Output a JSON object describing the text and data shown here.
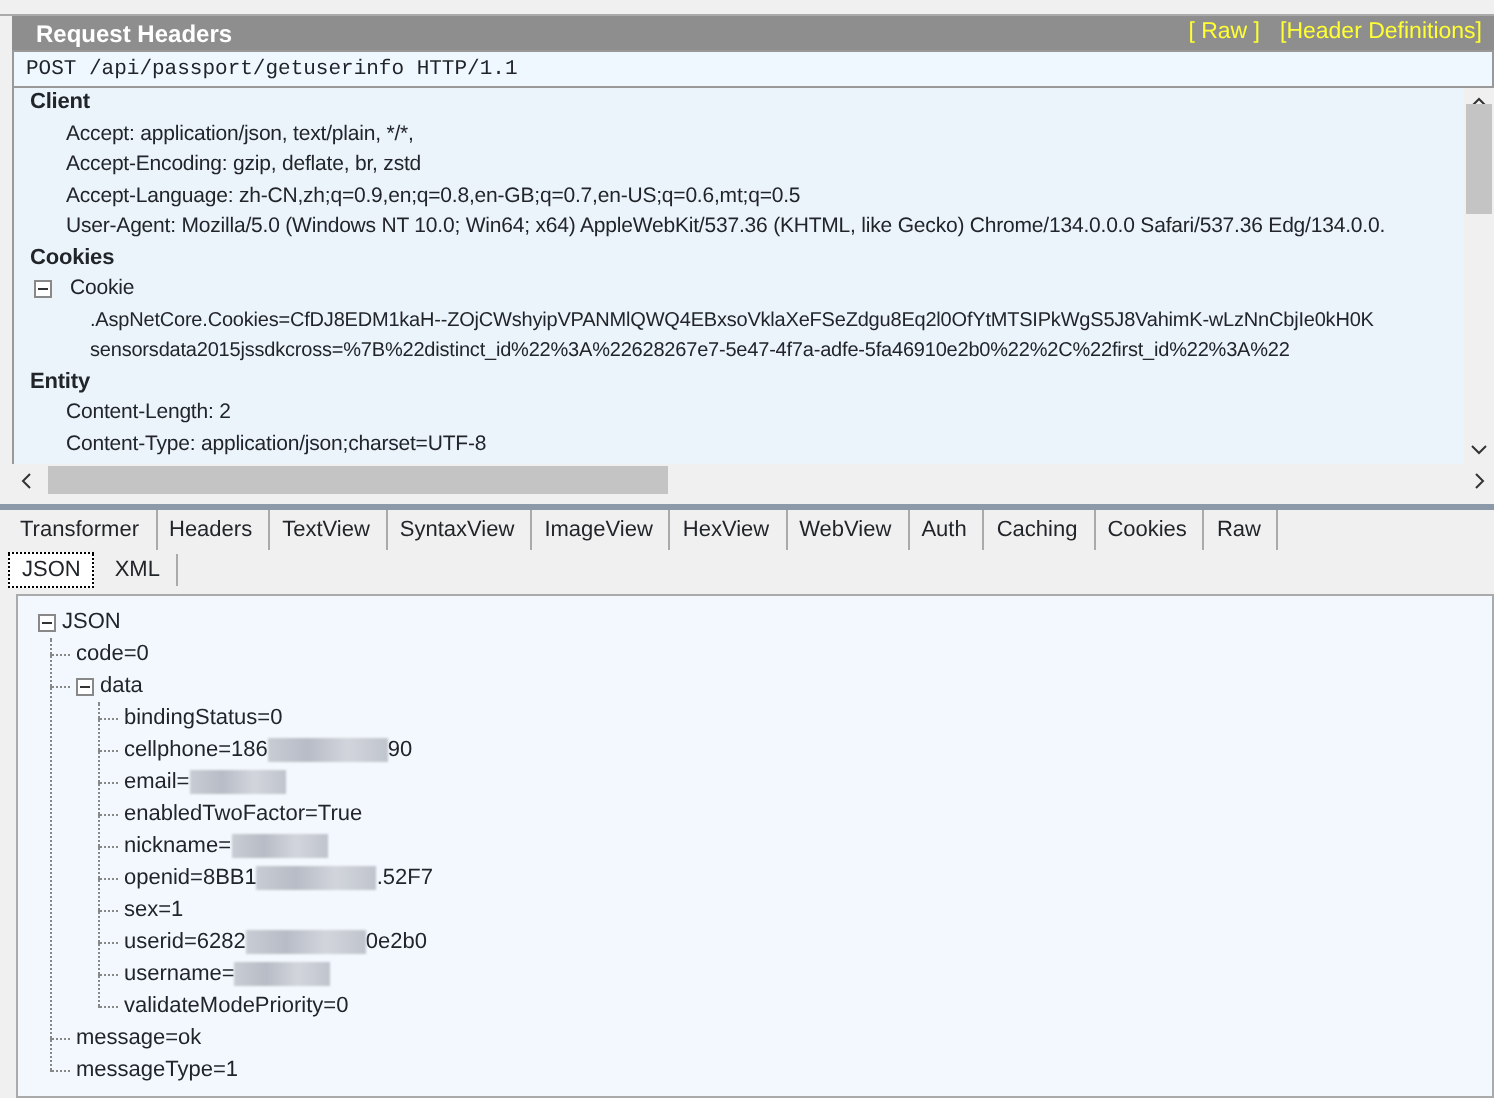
{
  "header": {
    "title": "Request Headers",
    "links": [
      "[ Raw ]",
      "[Header Definitions]"
    ]
  },
  "request_line": "POST /api/passport/getuserinfo HTTP/1.1",
  "groups": [
    {
      "name": "Client",
      "items": [
        {
          "text": "Accept: application/json, text/plain, */*,"
        },
        {
          "text": "Accept-Encoding: gzip, deflate, br, zstd"
        },
        {
          "text": "Accept-Language: zh-CN,zh;q=0.9,en;q=0.8,en-GB;q=0.7,en-US;q=0.6,mt;q=0.5"
        },
        {
          "text": "User-Agent: Mozilla/5.0 (Windows NT 10.0; Win64; x64) AppleWebKit/537.36 (KHTML, like Gecko) Chrome/134.0.0.0 Safari/537.36 Edg/134.0.0."
        }
      ]
    },
    {
      "name": "Cookies",
      "items": [
        {
          "text": "Cookie",
          "expanded": true,
          "children": [
            ".AspNetCore.Cookies=CfDJ8EDM1kaH--ZOjCWshyipVPANMlQWQ4EBxsoVklaXeFSeZdgu8Eq2l0OfYtMTSIPkWgS5J8VahimK-wLzNnCbjIe0kH0K",
            "sensorsdata2015jssdkcross=%7B%22distinct_id%22%3A%22628267e7-5e47-4f7a-adfe-5fa46910e2b0%22%2C%22first_id%22%3A%22"
          ]
        }
      ]
    },
    {
      "name": "Entity",
      "items": [
        {
          "text": "Content-Length: 2"
        },
        {
          "text": "Content-Type: application/json;charset=UTF-8"
        }
      ]
    }
  ],
  "inspector_tabs": [
    {
      "label": "Transformer",
      "selected": false
    },
    {
      "label": "Headers",
      "selected": false
    },
    {
      "label": "TextView",
      "selected": false
    },
    {
      "label": "SyntaxView",
      "selected": false
    },
    {
      "label": "ImageView",
      "selected": false
    },
    {
      "label": "HexView",
      "selected": false
    },
    {
      "label": "WebView",
      "selected": false
    },
    {
      "label": "Auth",
      "selected": false
    },
    {
      "label": "Caching",
      "selected": false
    },
    {
      "label": "Cookies",
      "selected": false
    },
    {
      "label": "Raw",
      "selected": false
    }
  ],
  "view_tabs": [
    {
      "label": "JSON",
      "selected": true
    },
    {
      "label": "XML",
      "selected": false
    }
  ],
  "tree": [
    {
      "label": "JSON",
      "expanded": true,
      "children": [
        {
          "label": "code=0"
        },
        {
          "label": "data",
          "expanded": true,
          "children": [
            {
              "label": "bindingStatus=0"
            },
            {
              "label": "cellphone=186",
              "redacted": true,
              "tail": "90"
            },
            {
              "label": "email=",
              "redacted": true
            },
            {
              "label": "enabledTwoFactor=True"
            },
            {
              "label": "nickname=",
              "redacted": true
            },
            {
              "label": "openid=8BB1",
              "redacted": true,
              "tail": ".52F7"
            },
            {
              "label": "sex=1"
            },
            {
              "label": "userid=6282",
              "redacted": true,
              "tail": "0e2b0"
            },
            {
              "label": "username=",
              "redacted": true
            },
            {
              "label": "validateModePriority=0"
            }
          ]
        },
        {
          "label": "message=ok"
        },
        {
          "label": "messageType=1"
        }
      ]
    }
  ]
}
